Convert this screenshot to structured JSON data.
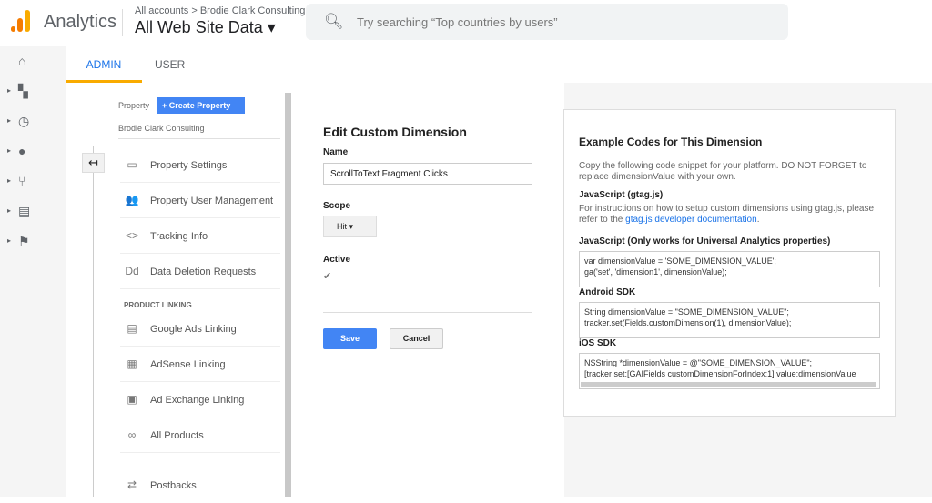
{
  "header": {
    "app_name": "Analytics",
    "breadcrumb": "All accounts > Brodie Clark Consulting",
    "view": "All Web Site Data ▾",
    "search_placeholder": "Try searching “Top countries by users”"
  },
  "tabs": {
    "admin": "ADMIN",
    "user": "USER"
  },
  "property": {
    "label": "Property",
    "create": "+ Create Property",
    "account": "Brodie Clark Consulting",
    "items": [
      {
        "icon": "▭",
        "label": "Property Settings"
      },
      {
        "icon": "👥",
        "label": "Property User Management"
      },
      {
        "icon": "<>",
        "label": "Tracking Info"
      },
      {
        "icon": "Dd",
        "label": "Data Deletion Requests"
      }
    ],
    "product_linking": "PRODUCT LINKING",
    "links": [
      {
        "icon": "▤",
        "label": "Google Ads Linking"
      },
      {
        "icon": "▦",
        "label": "AdSense Linking"
      },
      {
        "icon": "▣",
        "label": "Ad Exchange Linking"
      },
      {
        "icon": "∞",
        "label": "All Products"
      },
      {
        "icon": "⇄",
        "label": "Postbacks"
      }
    ]
  },
  "form": {
    "title": "Edit Custom Dimension",
    "name_label": "Name",
    "name_value": "ScrollToText Fragment Clicks",
    "scope_label": "Scope",
    "scope_value": "Hit ▾",
    "active_label": "Active",
    "active_check": "✔",
    "save": "Save",
    "cancel": "Cancel"
  },
  "panel": {
    "title": "Example Codes for This Dimension",
    "intro": "Copy the following code snippet for your platform. DO NOT FORGET to replace dimensionValue with your own.",
    "gtag_h": "JavaScript (gtag.js)",
    "gtag_text": "For instructions on how to setup custom dimensions using gtag.js, please refer to the",
    "gtag_link": "gtag.js developer documentation",
    "gtag_end": ".",
    "ua_h": "JavaScript (Only works for Universal Analytics properties)",
    "ua_l1": "var dimensionValue = 'SOME_DIMENSION_VALUE';",
    "ua_l2": "ga('set', 'dimension1', dimensionValue);",
    "android_h": "Android SDK",
    "and_l1": "String dimensionValue = \"SOME_DIMENSION_VALUE\";",
    "and_l2": "tracker.set(Fields.customDimension(1), dimensionValue);",
    "ios_h": "iOS SDK",
    "ios_l1": "NSString *dimensionValue = @\"SOME_DIMENSION_VALUE\";",
    "ios_l2": "[tracker set:[GAIFields customDimensionForIndex:1] value:dimensionValue"
  }
}
